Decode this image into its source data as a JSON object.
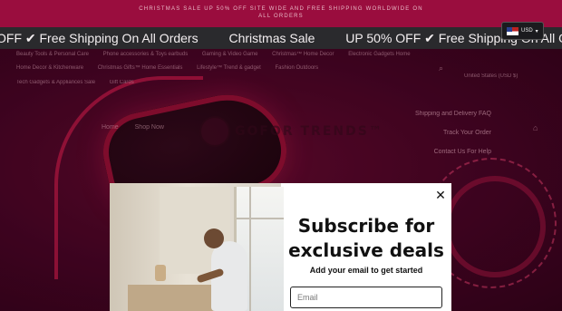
{
  "announcement": {
    "line1": "CHRISTMAS SALE UP 50% OFF SITE WIDE AND FREE SHIPPING WORLDWIDE ON",
    "line2": "ALL ORDERS"
  },
  "marquee": {
    "items": [
      "OFF ✔ Free Shipping On All Orders",
      "Christmas Sale",
      "UP 50% OFF ✔ Free Shipping On All Orders"
    ]
  },
  "currency": {
    "code": "USD",
    "arrow": "▾"
  },
  "nav": {
    "row1": [
      "Beauty Tools & Personal Care",
      "Phone accessories & Toys earbuds",
      "Gaming & Video Game",
      "Christmas™ Home Decor",
      "Electronic Gadgets Home"
    ],
    "row2": [
      "Home Decor & Kitchenware",
      "Christmas Gifts™ Home Essentials",
      "Lifestyle™ Trend & gadget",
      "Fashion Outdoors"
    ],
    "row3": [
      "Tech Gadgets & Appliances Sale",
      "Gift Cards"
    ],
    "currency_right": "United States (USD $)"
  },
  "header": {
    "logo_text": "GOFOR TRENDS™",
    "menu": [
      "Home",
      "Shop Now"
    ],
    "right_links": [
      "Shipping and Delivery FAQ",
      "Track Your Order",
      "Contact Us For Help"
    ]
  },
  "modal": {
    "title": "Subscribe for exclusive deals",
    "subtitle": "Add your email to get started",
    "email_placeholder": "Email",
    "close_symbol": "✕"
  }
}
